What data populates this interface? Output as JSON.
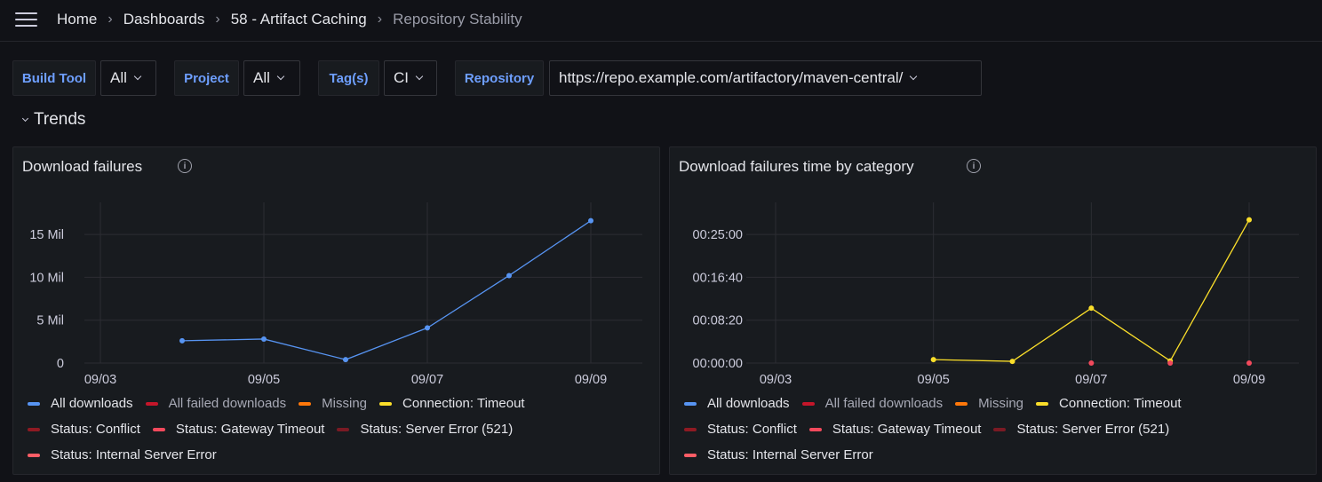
{
  "breadcrumb": {
    "items": [
      "Home",
      "Dashboards",
      "58 - Artifact Caching"
    ],
    "current": "Repository Stability"
  },
  "variables": {
    "build_tool_label": "Build Tool",
    "build_tool_value": "All",
    "project_label": "Project",
    "project_value": "All",
    "tags_label": "Tag(s)",
    "tags_value": "CI",
    "repository_label": "Repository",
    "repository_value": "https://repo.example.com/artifactory/maven-central/"
  },
  "row": {
    "title": "Trends"
  },
  "colors": {
    "all_downloads": "#5794f2",
    "all_failed_downloads": "#c4162a",
    "missing": "#ff780a",
    "connection_timeout": "#fade2a",
    "status_conflict": "#8f1a23",
    "status_gateway_timeout": "#f2495c",
    "status_server_error_521": "#7a1a24",
    "status_internal_server_error": "#ff5d66"
  },
  "legend": [
    {
      "label": "All downloads",
      "color": "#5794f2"
    },
    {
      "label": "All failed downloads",
      "color": "#c4162a"
    },
    {
      "label": "Missing",
      "color": "#ff780a"
    },
    {
      "label": "Connection: Timeout",
      "color": "#fade2a"
    },
    {
      "label": "Status: Conflict",
      "color": "#8f1a23"
    },
    {
      "label": "Status: Gateway Timeout",
      "color": "#f2495c"
    },
    {
      "label": "Status: Server Error (521)",
      "color": "#7a1a24"
    },
    {
      "label": "Status: Internal Server Error",
      "color": "#ff5d66"
    }
  ],
  "panels": {
    "left": {
      "title": "Download failures"
    },
    "right": {
      "title": "Download failures time by category"
    }
  },
  "chart_data": [
    {
      "type": "line",
      "title": "Download failures",
      "x_ticks": [
        "09/03",
        "09/05",
        "09/07",
        "09/09"
      ],
      "y_ticks": [
        "0",
        "5 Mil",
        "10 Mil",
        "15 Mil"
      ],
      "ylim": [
        0,
        18000000
      ],
      "xlim": [
        "09/03",
        "09/09"
      ],
      "grid": true,
      "legend_position": "bottom",
      "series": [
        {
          "name": "All downloads",
          "color": "#5794f2",
          "x": [
            "09/04",
            "09/05",
            "09/06",
            "09/07",
            "09/08",
            "09/09"
          ],
          "y": [
            2600000,
            2800000,
            400000,
            4100000,
            10200000,
            16600000
          ]
        }
      ]
    },
    {
      "type": "line",
      "title": "Download failures time by category",
      "x_ticks": [
        "09/03",
        "09/05",
        "09/07",
        "09/09"
      ],
      "y_ticks": [
        "00:00:00",
        "00:08:20",
        "00:16:40",
        "00:25:00"
      ],
      "ylim": [
        0,
        1800
      ],
      "xlim": [
        "09/03",
        "09/09"
      ],
      "grid": true,
      "legend_position": "bottom",
      "series": [
        {
          "name": "Connection: Timeout",
          "color": "#fade2a",
          "x": [
            "09/05",
            "09/06",
            "09/07",
            "09/08",
            "09/09"
          ],
          "y": [
            40,
            20,
            640,
            25,
            1670
          ]
        },
        {
          "name": "Status: Gateway Timeout",
          "color": "#f2495c",
          "x": [
            "09/07",
            "09/08",
            "09/09"
          ],
          "y": [
            0,
            0,
            0
          ]
        }
      ]
    }
  ]
}
